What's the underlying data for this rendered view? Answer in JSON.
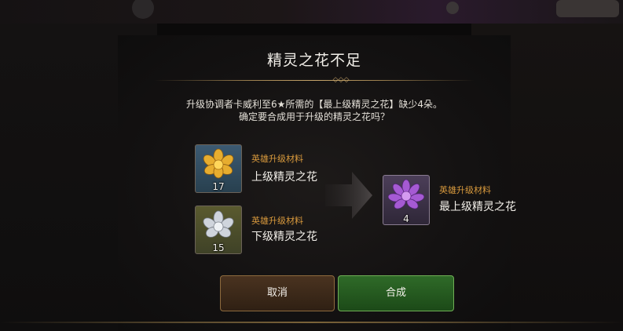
{
  "dialog": {
    "title": "精灵之花不足",
    "message_line1": "升级协调者卡威利至6★所需的【最上级精灵之花】缺少4朵。",
    "message_line2": "确定要合成用于升级的精灵之花吗？"
  },
  "materials": [
    {
      "type_label": "英雄升级材料",
      "name": "上级精灵之花",
      "count": "17",
      "icon": "gold-spirit-flower-icon",
      "color": "#e0a92e"
    },
    {
      "type_label": "英雄升级材料",
      "name": "下级精灵之花",
      "count": "15",
      "icon": "silver-spirit-flower-icon",
      "color": "#c9ced6"
    }
  ],
  "result": {
    "type_label": "英雄升级材料",
    "name": "最上级精灵之花",
    "count": "4",
    "icon": "purple-spirit-flower-icon",
    "color": "#a95cd6"
  },
  "buttons": {
    "cancel": "取消",
    "confirm": "合成"
  },
  "colors": {
    "type_label": "#d99a3d",
    "confirm_button": "#2f6a28",
    "cancel_button": "#4a3320"
  }
}
